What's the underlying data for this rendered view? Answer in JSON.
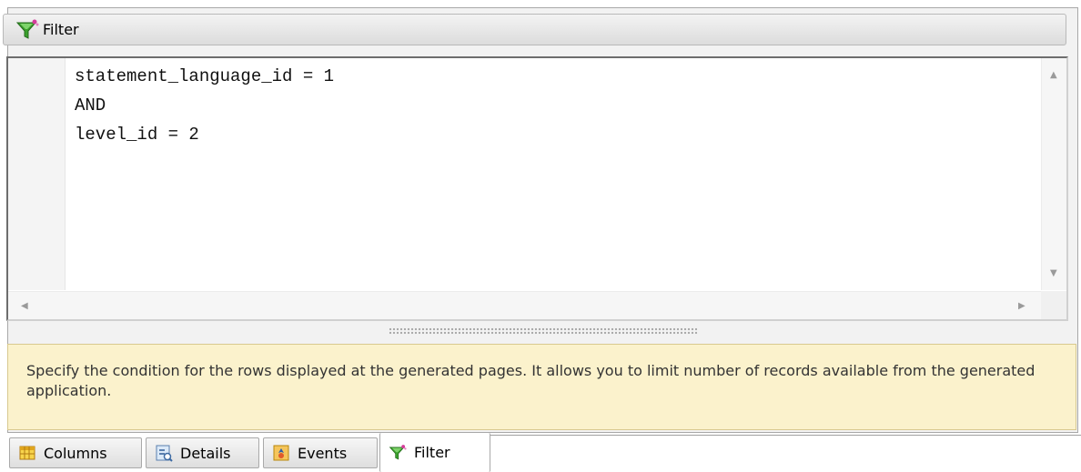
{
  "header": {
    "title": "Filter",
    "icon": "funnel-icon"
  },
  "editor": {
    "lines": [
      "statement_language_id = 1",
      "AND",
      "level_id = 2"
    ]
  },
  "hint": {
    "text": "Specify the condition for the rows displayed at the generated pages. It allows you to limit number of records available from the generated application."
  },
  "tabs": [
    {
      "label": "Columns",
      "icon": "table-icon",
      "active": false
    },
    {
      "label": "Details",
      "icon": "details-icon",
      "active": false
    },
    {
      "label": "Events",
      "icon": "events-icon",
      "active": false
    },
    {
      "label": "Filter",
      "icon": "funnel-icon",
      "active": true
    }
  ],
  "colors": {
    "hint_bg": "#fbf2cc",
    "funnel_green": "#3aa02c",
    "funnel_pink": "#d43c9a"
  }
}
